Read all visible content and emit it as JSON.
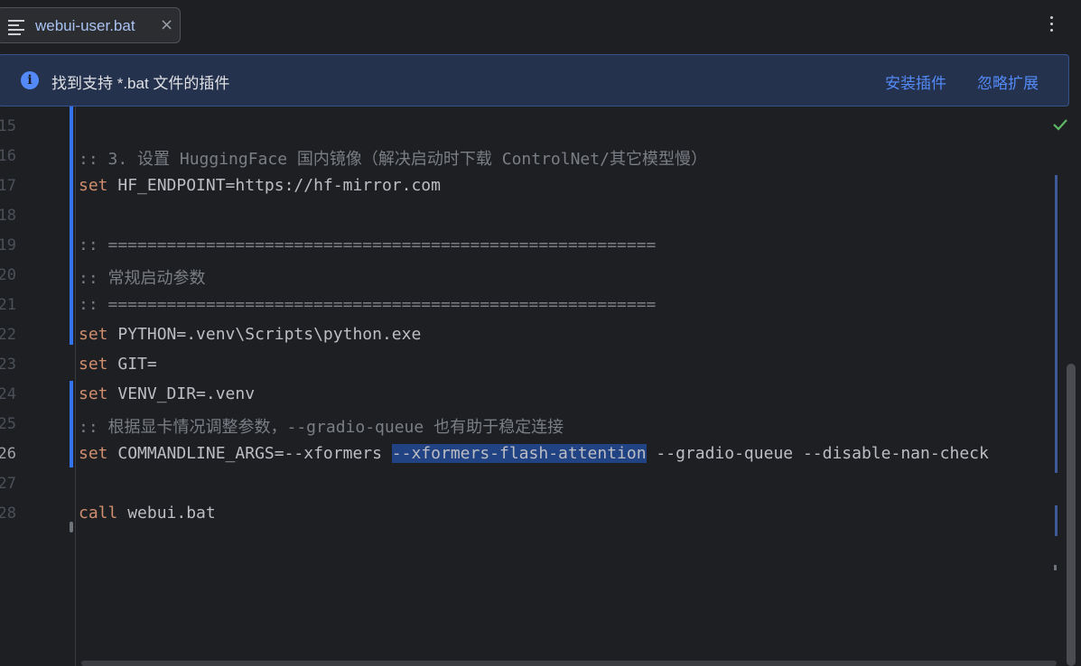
{
  "tab": {
    "label": "webui-user.bat",
    "icon": "file-text-icon",
    "close": "×"
  },
  "banner": {
    "icon": "info-icon",
    "message": "找到支持 *.bat 文件的插件",
    "install_label": "安装插件",
    "ignore_label": "忽略扩展"
  },
  "editor": {
    "current_line": 26,
    "lines": [
      {
        "num": "15"
      },
      {
        "num": "16",
        "comment": ":: 3. 设置 HuggingFace 国内镜像（解决启动时下载 ControlNet/其它模型慢）"
      },
      {
        "num": "17",
        "kw": "set",
        "text": " HF_ENDPOINT=https://hf-mirror.com"
      },
      {
        "num": "18"
      },
      {
        "num": "19",
        "comment": ":: ========================================================"
      },
      {
        "num": "20",
        "comment": ":: 常规启动参数"
      },
      {
        "num": "21",
        "comment": ":: ========================================================"
      },
      {
        "num": "22",
        "kw": "set",
        "text": " PYTHON=.venv\\Scripts\\python.exe"
      },
      {
        "num": "23",
        "kw": "set",
        "text": " GIT="
      },
      {
        "num": "24",
        "kw": "set",
        "text": " VENV_DIR=.venv"
      },
      {
        "num": "25",
        "comment": ":: 根据显卡情况调整参数，--gradio-queue 也有助于稳定连接"
      },
      {
        "num": "26",
        "kw": "set",
        "text_before": " COMMANDLINE_ARGS=--xformers ",
        "selected": "--xformers-flash-attention",
        "text_after": " --gradio-queue --disable-nan-check"
      },
      {
        "num": "27"
      },
      {
        "num": "28",
        "kw": "call",
        "text": " webui.bat"
      }
    ]
  },
  "colors": {
    "keyword": "#cf8e6d",
    "comment": "#7a7e85",
    "selection": "#214283",
    "link": "#548af7",
    "change": "#3574f0"
  }
}
